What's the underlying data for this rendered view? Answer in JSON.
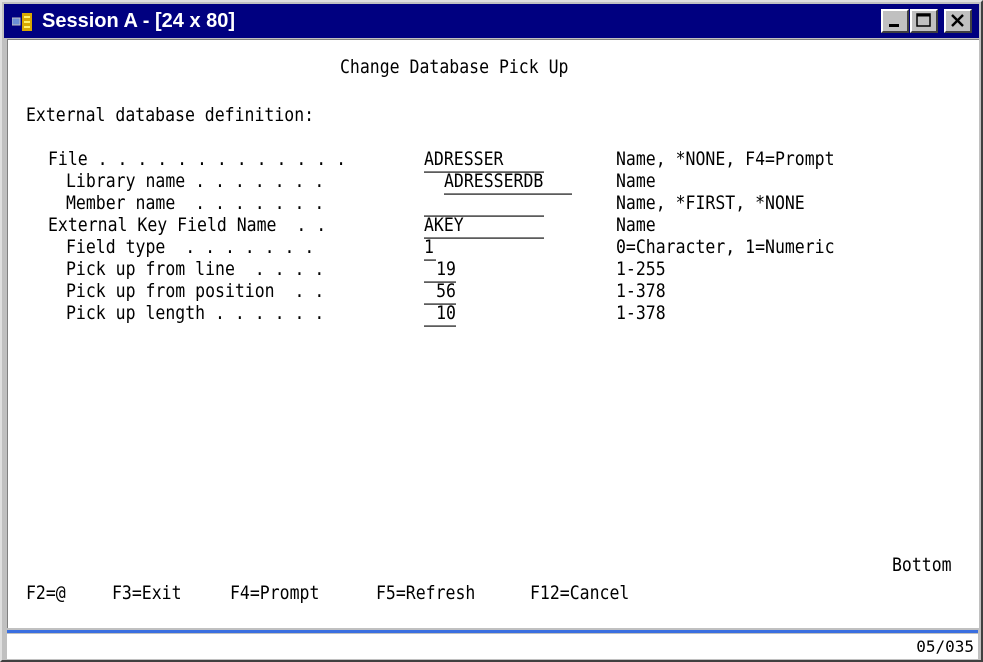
{
  "window": {
    "title": "Session A - [24 x 80]",
    "icon": "terminal-session-icon",
    "title_bar_color": "#000080",
    "controls": {
      "minimize": "minimize-icon",
      "maximize": "maximize-icon",
      "close": "close-icon"
    }
  },
  "screen": {
    "title": "Change Database Pick Up",
    "section_label": "External database definition:",
    "fields": [
      {
        "label": "File . . . . . . . . . . . . .",
        "value": "ADRESSER",
        "hint": "Name, *NONE, F4=Prompt"
      },
      {
        "label": "Library name . . . . . . .",
        "value": "ADRESSERDB",
        "hint": "Name"
      },
      {
        "label": "Member name  . . . . . . .",
        "value": "",
        "hint": "Name, *FIRST, *NONE"
      },
      {
        "label": "External Key Field Name  . .",
        "value": "AKEY",
        "hint": "Name"
      },
      {
        "label": "Field type  . . . . . . .",
        "value": "1",
        "hint": "0=Character, 1=Numeric"
      },
      {
        "label": "Pick up from line  . . . .",
        "value": "19",
        "hint": "1-255"
      },
      {
        "label": "Pick up from position  . .",
        "value": "56",
        "hint": "1-378"
      },
      {
        "label": "Pick up length . . . . . .",
        "value": "10",
        "hint": "1-378"
      }
    ],
    "scroll_indicator": "Bottom",
    "function_keys": [
      "F2=@",
      "F3=Exit",
      "F4=Prompt",
      "F5=Refresh",
      "F12=Cancel"
    ]
  },
  "status": {
    "cursor_position": "05/035"
  }
}
